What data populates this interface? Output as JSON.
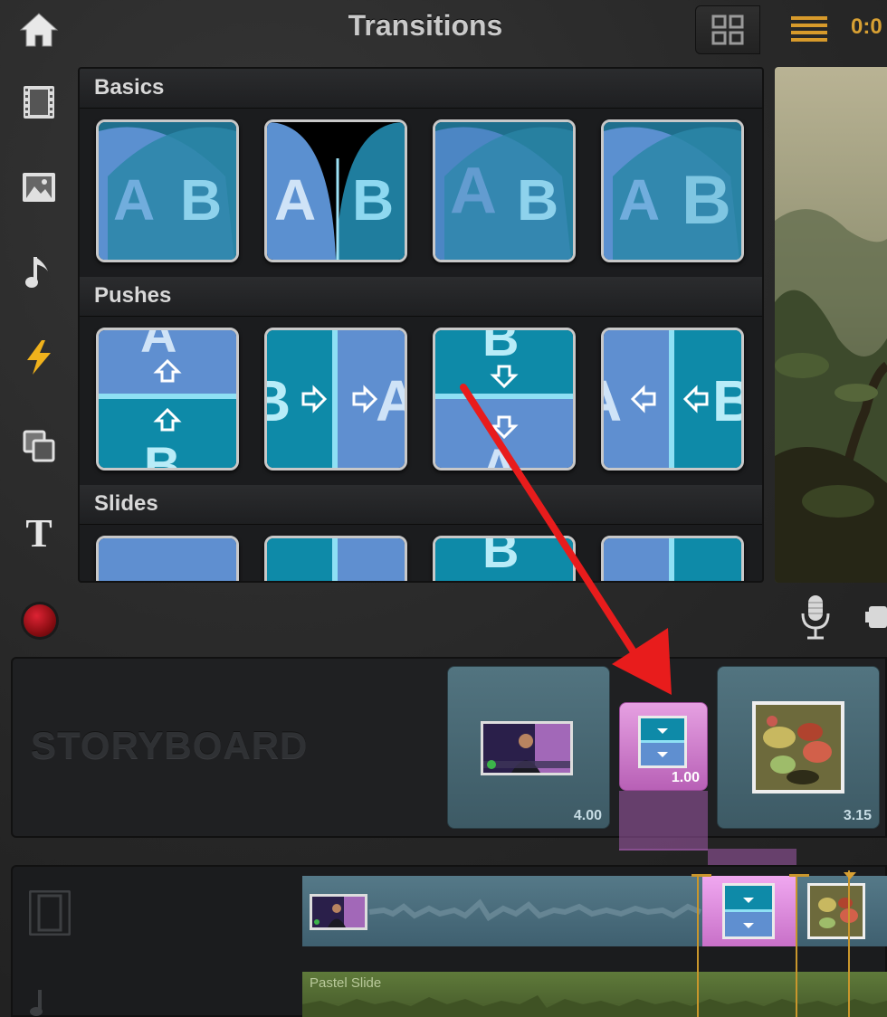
{
  "header": {
    "title": "Transitions",
    "time_readout": "0:0"
  },
  "sidebar": {
    "items": [
      {
        "icon": "home-icon"
      },
      {
        "icon": "film-strip-icon"
      },
      {
        "icon": "photo-icon"
      },
      {
        "icon": "music-note-icon"
      },
      {
        "icon": "lightning-icon",
        "active": true
      },
      {
        "icon": "overlay-icon"
      },
      {
        "icon": "title-text-icon",
        "glyph": "T"
      }
    ]
  },
  "browser": {
    "sections": [
      {
        "label": "Basics"
      },
      {
        "label": "Pushes"
      },
      {
        "label": "Slides"
      }
    ],
    "thumb_letters": {
      "a": "A",
      "b": "B"
    }
  },
  "storyboard": {
    "label": "STORYBOARD",
    "clips": [
      {
        "duration": "4.00"
      },
      {
        "duration": "1.00",
        "kind": "transition"
      },
      {
        "duration": "3.15"
      }
    ]
  },
  "timeline": {
    "audio_clip_label": "Pastel Slide"
  },
  "colors": {
    "accent_time": "#d8a033",
    "transition_pink": "#d88ad6",
    "clip_teal": "#4d6d79",
    "arrow_red": "#e81c1c",
    "audio_green": "#5a7436"
  }
}
